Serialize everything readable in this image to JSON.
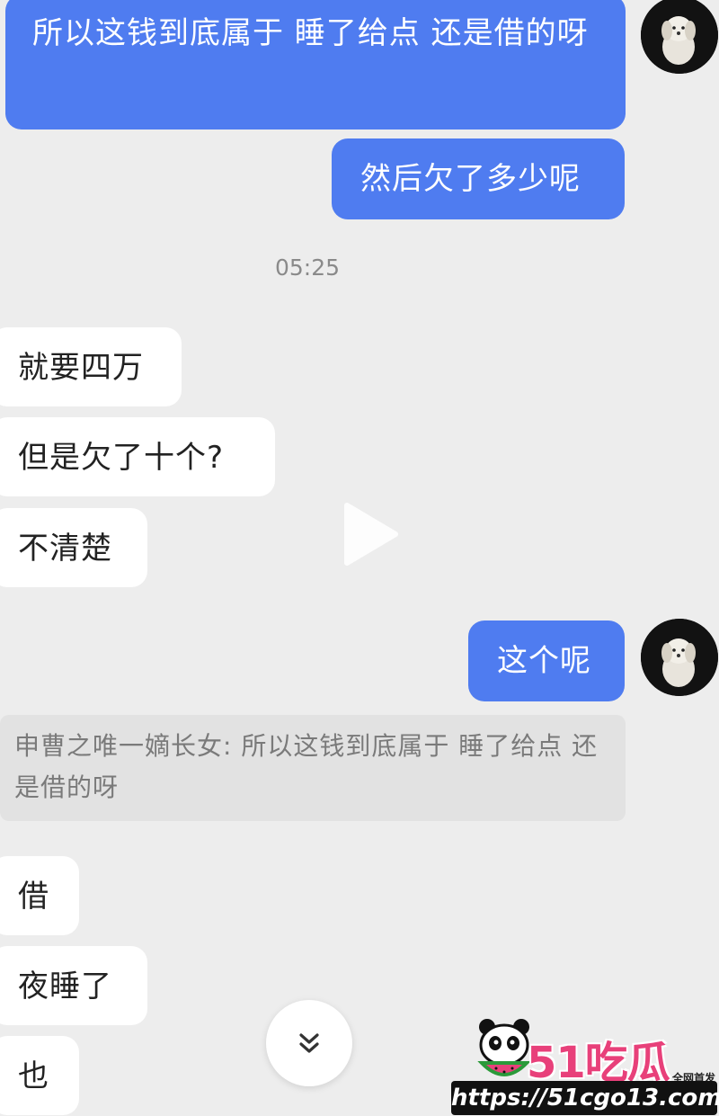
{
  "messages": {
    "out_1": "所以这钱到底属于 睡了给点 还是借的呀",
    "out_2": "然后欠了多少呢",
    "timestamp": "05:25",
    "in_1": "就要四万",
    "in_2": "但是欠了十个?",
    "in_3": "不清楚",
    "out_3": "这个呢",
    "quote": "申曹之唯一嫡长女: 所以这钱到底属于 睡了给点 还是借的呀",
    "in_4": "借",
    "in_5": "夜睡了",
    "in_6": "也"
  },
  "icons": {
    "avatar": "dog-avatar",
    "play": "play-icon",
    "scroll": "chevron-double-down-icon"
  },
  "watermark": {
    "brand": "51吃瓜",
    "tagline": "全网首发",
    "url": "https://51cgo13.com"
  },
  "colors": {
    "background": "#ededed",
    "outgoing_bubble": "#4f7cf0",
    "incoming_bubble": "#ffffff",
    "quote_bg": "#e2e2e2",
    "brand": "#e8407a"
  }
}
